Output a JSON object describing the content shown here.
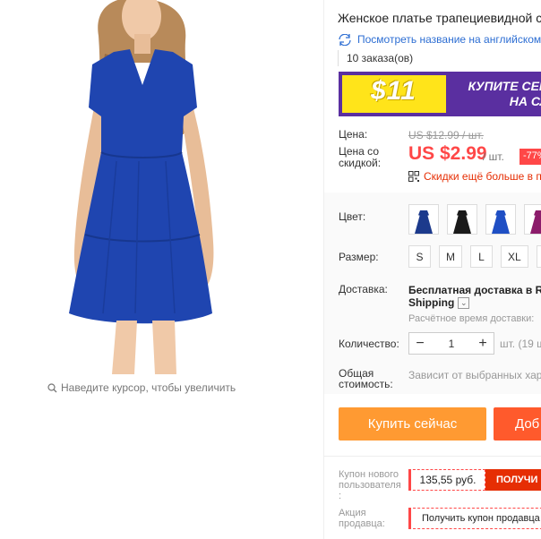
{
  "gallery": {
    "zoom_hint": "Наведите курсор, чтобы увеличить"
  },
  "product": {
    "title": "Женское платье трапециевидной с",
    "translate_link": "Посмотреть название на английском",
    "orders": "10 заказа(ов)"
  },
  "banner": {
    "amount": "$11",
    "cta_line1": "КУПИТЕ СЕЙЧА",
    "cta_line2": "НА СЛЕД",
    "colors": {
      "bg": "#5a2fa0",
      "yellow": "#ffe41a"
    }
  },
  "pricing": {
    "price_label": "Цена:",
    "old_price": "US $12.99 / шт.",
    "discount_label_1": "Цена со",
    "discount_label_2": "скидкой:",
    "price": "US $2.99",
    "per_unit": "/ шт.",
    "discount_badge": "-77%",
    "more_discounts": "Скидки ещё больше в пр"
  },
  "options": {
    "color_label": "Цвет:",
    "colors": [
      "#1c3a8c",
      "#1a1a1a",
      "#1f4fc4",
      "#8c1c6b"
    ],
    "size_label": "Размер:",
    "sizes": [
      "S",
      "M",
      "L",
      "XL",
      ""
    ]
  },
  "shipping": {
    "label": "Доставка:",
    "title": "Бесплатная доставка в Rus",
    "method": "Shipping",
    "estimate": "Расчётное время доставки:"
  },
  "quantity": {
    "label": "Количество:",
    "value": "1",
    "minus": "−",
    "plus": "+",
    "note": "шт. (19 ш"
  },
  "total": {
    "label_1": "Общая",
    "label_2": "стоимость:",
    "note": "Зависит от выбранных хара"
  },
  "actions": {
    "buy_now": "Купить сейчас",
    "add_to_cart": "Доб"
  },
  "coupons": {
    "new_user_label_1": "Купон нового",
    "new_user_label_2": "пользователя",
    "new_user_label_3": ":",
    "new_user_value": "135,55 руб.",
    "new_user_btn": "ПОЛУЧИ",
    "seller_label_1": "Акция",
    "seller_label_2": "продавца:",
    "seller_btn": "Получить купон продавца"
  }
}
